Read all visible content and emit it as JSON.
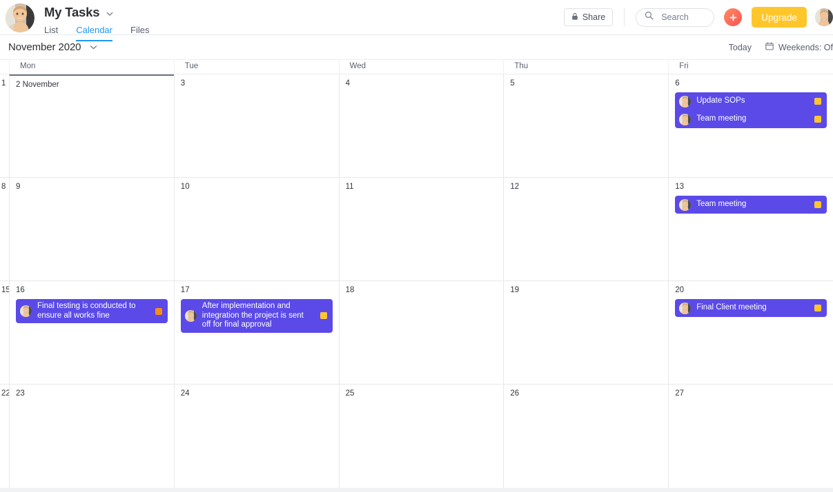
{
  "header": {
    "title": "My Tasks",
    "title_caret_icon": "chevron-down-icon",
    "avatar_icon": "user-avatar",
    "tabs": [
      {
        "label": "List",
        "active": false
      },
      {
        "label": "Calendar",
        "active": true
      },
      {
        "label": "Files",
        "active": false
      }
    ],
    "share_label": "Share",
    "share_icon": "lock-icon",
    "search": {
      "placeholder": "Search",
      "value": "",
      "icon": "search-icon"
    },
    "add_button_icon": "plus-icon",
    "upgrade_label": "Upgrade",
    "user_avatar_icon": "user-avatar-small"
  },
  "datenav": {
    "month_label": "November 2020",
    "month_caret_icon": "chevron-down-icon",
    "today_label": "Today",
    "weekends_label": "Weekends: Of",
    "weekends_icon": "calendar-icon"
  },
  "calendar": {
    "weekday_headers": [
      "Mon",
      "Tue",
      "Wed",
      "Thu",
      "Fri"
    ],
    "colors": {
      "event_bg": "#5b4ae8",
      "badge_yellow": "#ffc62b",
      "badge_orange": "#fa8c16",
      "accent_tab": "#2196f3",
      "upgrade_bg": "#ffc62b",
      "add_bg": "#fb6a5a"
    },
    "weeks": [
      {
        "gutter_daynum": "1",
        "days": [
          {
            "daynum": "2 November",
            "today": true,
            "events": []
          },
          {
            "daynum": "3",
            "today": false,
            "events": []
          },
          {
            "daynum": "4",
            "today": false,
            "events": []
          },
          {
            "daynum": "5",
            "today": false,
            "events": []
          },
          {
            "daynum": "6",
            "today": false,
            "events": [
              {
                "title": "Update SOPs",
                "badge": "#ffc62b"
              },
              {
                "title": "Team meeting",
                "badge": "#ffc62b"
              }
            ]
          }
        ]
      },
      {
        "gutter_daynum": "8",
        "days": [
          {
            "daynum": "9",
            "today": false,
            "events": []
          },
          {
            "daynum": "10",
            "today": false,
            "events": []
          },
          {
            "daynum": "11",
            "today": false,
            "events": []
          },
          {
            "daynum": "12",
            "today": false,
            "events": []
          },
          {
            "daynum": "13",
            "today": false,
            "events": [
              {
                "title": "Team meeting",
                "badge": "#ffc62b"
              }
            ]
          }
        ]
      },
      {
        "gutter_daynum": "15",
        "days": [
          {
            "daynum": "16",
            "today": false,
            "events": [
              {
                "title": "Final testing is conducted to ensure all works fine",
                "badge": "#fa8c16"
              }
            ]
          },
          {
            "daynum": "17",
            "today": false,
            "events": [
              {
                "title": "After implementation and integration the project is sent off for final approval",
                "badge": "#ffc62b"
              }
            ]
          },
          {
            "daynum": "18",
            "today": false,
            "events": []
          },
          {
            "daynum": "19",
            "today": false,
            "events": []
          },
          {
            "daynum": "20",
            "today": false,
            "events": [
              {
                "title": "Final Client meeting",
                "badge": "#ffc62b"
              }
            ]
          }
        ]
      },
      {
        "gutter_daynum": "22",
        "days": [
          {
            "daynum": "23",
            "today": false,
            "events": []
          },
          {
            "daynum": "24",
            "today": false,
            "events": []
          },
          {
            "daynum": "25",
            "today": false,
            "events": []
          },
          {
            "daynum": "26",
            "today": false,
            "events": []
          },
          {
            "daynum": "27",
            "today": false,
            "events": []
          }
        ]
      }
    ]
  }
}
